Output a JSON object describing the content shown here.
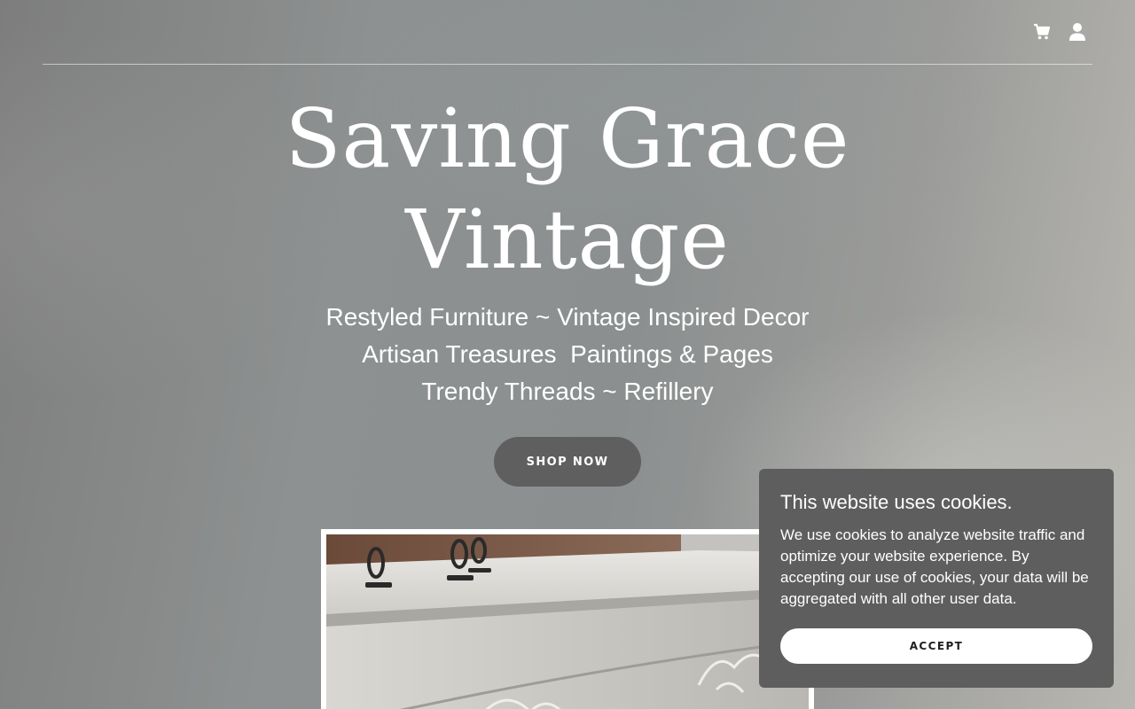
{
  "header": {
    "icons": [
      "cart-icon",
      "user-icon"
    ]
  },
  "hero": {
    "title_line1": "Saving Grace",
    "title_line2": "Vintage",
    "tagline": [
      "Restyled Furniture ~ Vintage Inspired Decor",
      "Artisan Treasures  Paintings & Pages",
      "Trendy Threads ~ Refillery"
    ],
    "cta_label": "SHOP NOW"
  },
  "cookie_banner": {
    "title": "This website uses cookies.",
    "body": "We use cookies to analyze website traffic and optimize your website experience. By accepting our use of cookies, your data will be aggregated with all other user data.",
    "accept_label": "ACCEPT"
  },
  "colors": {
    "button_dark": "#5f5f5f",
    "banner_bg": "#5e5e5e",
    "text": "#ffffff"
  }
}
